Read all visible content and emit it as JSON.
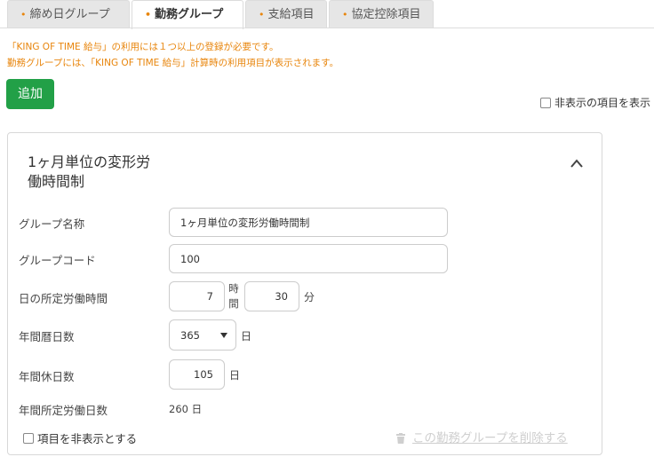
{
  "tabs": [
    {
      "label": "締め日グループ",
      "active": false
    },
    {
      "label": "勤務グループ",
      "active": true
    },
    {
      "label": "支給項目",
      "active": false
    },
    {
      "label": "協定控除項目",
      "active": false
    }
  ],
  "tab_dot": "•",
  "notice": {
    "line1": "「KING OF TIME 給与」の利用には１つ以上の登録が必要です。",
    "line2": "勤務グループには、「KING OF TIME 給与」計算時の利用項目が表示されます。"
  },
  "add_button": "追加",
  "show_hidden_label": "非表示の項目を表示",
  "card": {
    "title_line1": "1ヶ月単位の変形労",
    "title_line2": "働時間制",
    "fields": {
      "group_name": {
        "label": "グループ名称",
        "value": "1ヶ月単位の変形労働時間制"
      },
      "group_code": {
        "label": "グループコード",
        "value": "100"
      },
      "daily_hours": {
        "label": "日の所定労働時間",
        "hours": "7",
        "hours_unit_1": "時",
        "hours_unit_2": "間",
        "minutes": "30",
        "minutes_unit": "分"
      },
      "calendar_days": {
        "label": "年間暦日数",
        "value": "365",
        "unit": "日"
      },
      "holidays": {
        "label": "年間休日数",
        "value": "105",
        "unit": "日"
      },
      "work_days": {
        "label": "年間所定労働日数",
        "value": "260",
        "unit": "日"
      }
    },
    "hide_item_label": "項目を非表示とする",
    "delete_label": "この勤務グループを削除する"
  },
  "colors": {
    "accent_orange": "#e8850c",
    "add_green": "#22a047"
  }
}
